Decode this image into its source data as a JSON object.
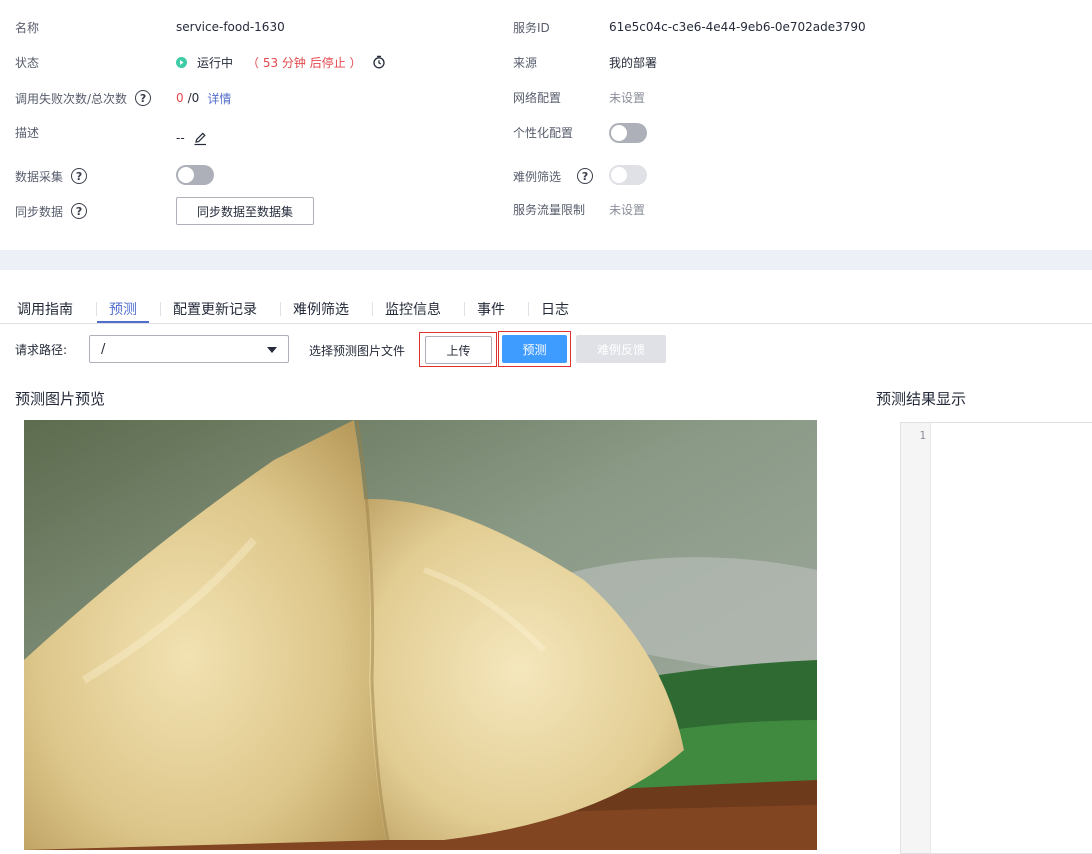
{
  "info": {
    "name_label": "名称",
    "name_value": "service-food-1630",
    "status_label": "状态",
    "status_value": "运行中",
    "status_warning": "（ 53 分钟 后停止 ）",
    "calls_label": "调用失败次数/总次数",
    "calls_failed": "0",
    "calls_total": "/0",
    "calls_detail": "详情",
    "desc_label": "描述",
    "desc_value": "--",
    "collect_label": "数据采集",
    "sync_label": "同步数据",
    "sync_button": "同步数据至数据集",
    "service_id_label": "服务ID",
    "service_id_value": "61e5c04c-c3e6-4e44-9eb6-0e702ade3790",
    "source_label": "来源",
    "source_value": "我的部署",
    "network_label": "网络配置",
    "network_value": "未设置",
    "personal_label": "个性化配置",
    "hard_label": "难例筛选",
    "limit_label": "服务流量限制",
    "limit_value": "未设置",
    "help_glyph": "?",
    "toggles": {
      "collect_on": false,
      "personal_on": false,
      "hard_enabled": false
    },
    "colors": {
      "running": "#3dcca6",
      "warning": "#e5484d",
      "link": "#526ecc"
    }
  },
  "tabs": [
    {
      "label": "调用指南",
      "active": false
    },
    {
      "label": "预测",
      "active": true
    },
    {
      "label": "配置更新记录",
      "active": false
    },
    {
      "label": "难例筛选",
      "active": false
    },
    {
      "label": "监控信息",
      "active": false
    },
    {
      "label": "事件",
      "active": false
    },
    {
      "label": "日志",
      "active": false
    }
  ],
  "predict": {
    "path_label": "请求路径:",
    "path_value": "/",
    "choose_label": "选择预测图片文件",
    "upload_button": "上传",
    "predict_button": "预测",
    "feedback_button": "难例反馈",
    "preview_title": "预测图片预览",
    "result_title": "预测结果显示",
    "line_number": "1",
    "colors": {
      "primary": "#3e9bff",
      "highlight": "#e03131"
    }
  }
}
